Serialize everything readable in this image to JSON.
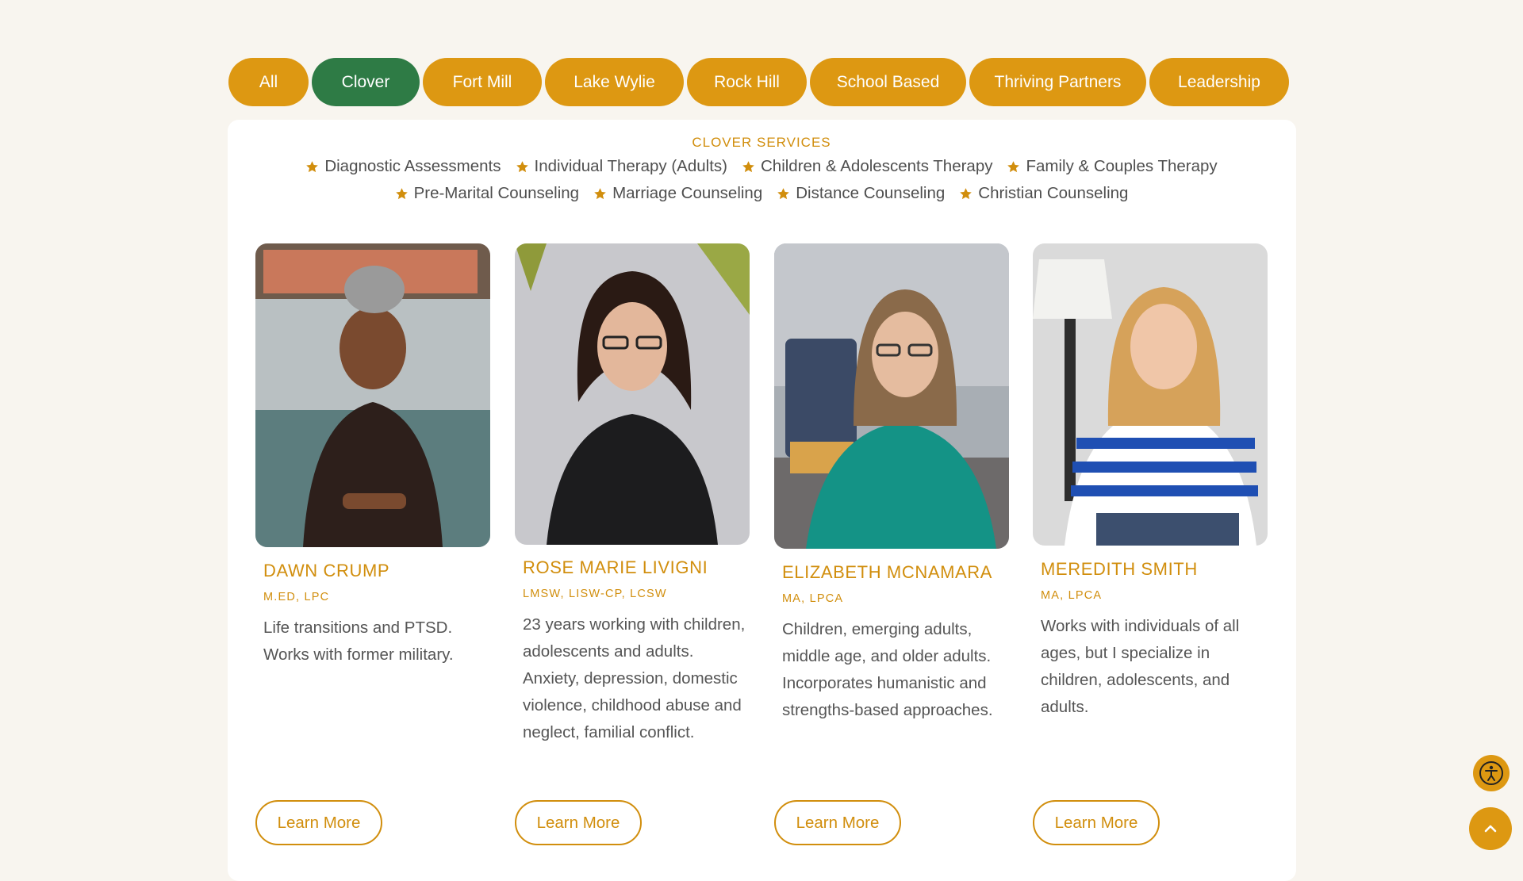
{
  "filters": {
    "tabs": [
      {
        "label": "All",
        "active": false
      },
      {
        "label": "Clover",
        "active": true
      },
      {
        "label": "Fort Mill",
        "active": false
      },
      {
        "label": "Lake Wylie",
        "active": false
      },
      {
        "label": "Rock Hill",
        "active": false
      },
      {
        "label": "School Based",
        "active": false
      },
      {
        "label": "Thriving Partners",
        "active": false
      },
      {
        "label": "Leadership",
        "active": false
      }
    ]
  },
  "services": {
    "title": "CLOVER SERVICES",
    "items": [
      "Diagnostic Assessments",
      "Individual Therapy (Adults)",
      "Children & Adolescents Therapy",
      "Family & Couples Therapy",
      "Pre-Marital Counseling",
      "Marriage Counseling",
      "Distance Counseling",
      "Christian Counseling"
    ],
    "icon": "star-icon"
  },
  "team": [
    {
      "name": "DAWN CRUMP",
      "credentials": "M.ED, LPC",
      "bio": "Life transitions and PTSD. Works with former military.",
      "button": "Learn More"
    },
    {
      "name": "ROSE MARIE LIVIGNI",
      "credentials": "LMSW, LISW-CP, LCSW",
      "bio": "23 years working with children, adolescents and adults. Anxiety, depression, domestic violence, childhood abuse and neglect, familial conflict.",
      "button": "Learn More"
    },
    {
      "name": "ELIZABETH MCNAMARA",
      "credentials": "MA, LPCA",
      "bio": "Children, emerging adults, middle age, and older adults. Incorporates humanistic and strengths-based approaches.",
      "button": "Learn More"
    },
    {
      "name": "MEREDITH SMITH",
      "credentials": "MA, LPCA",
      "bio": "Works with individuals of all ages, but I specialize in children, adolescents, and adults.",
      "button": "Learn More"
    }
  ],
  "floating": {
    "accessibility_icon": "accessibility-icon",
    "top_icon": "chevron-up-icon"
  },
  "colors": {
    "accent": "#dd9812",
    "active_tab": "#2e7b45",
    "text_gold": "#d18e0d",
    "background": "#f8f5ef"
  }
}
